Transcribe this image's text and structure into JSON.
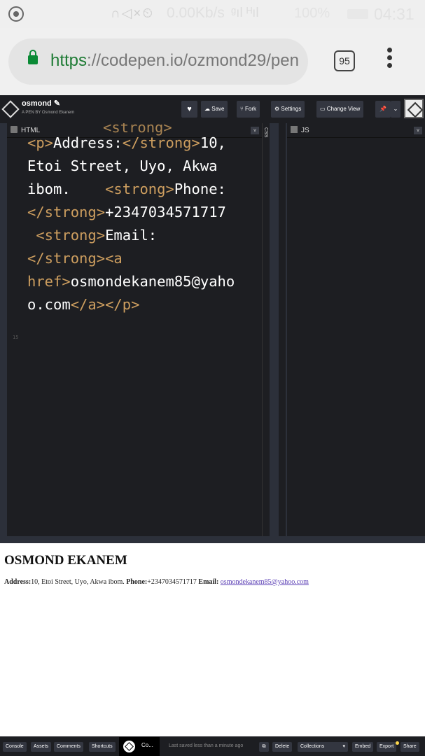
{
  "status_bar": {
    "net_speed": "0.00Kb/s",
    "battery": "100%",
    "time": "04:31"
  },
  "browser": {
    "url_protocol": "https",
    "url_rest": "://codepen.io/ozmond29/pen",
    "tab_count": "95"
  },
  "pen": {
    "title": "osmond",
    "byline": "A PEN BY Osmond Ekanem",
    "buttons": {
      "save": "Save",
      "fork": "Fork",
      "settings": "Settings",
      "change_view": "Change View"
    }
  },
  "editor": {
    "html_label": "HTML",
    "css_label": "CSS",
    "js_label": "JS",
    "code": {
      "partial_top": "<strong>",
      "line1_tag_open": "<p>",
      "line1_text": "Address:",
      "line1_tag_close": "</strong>",
      "line1_value": "10,",
      "line2": "Etoi Street, Uyo, Akwa",
      "line3_text": "ibom.    ",
      "line3_tag": "<strong>",
      "line3_value": "Phone:",
      "line4_tag": "</strong>",
      "line4_value": "+2347034571717",
      "line5_tag": " <strong>",
      "line5_value": "Email:",
      "line6_tag": "</strong><a",
      "line7_tag": "href>",
      "line7_value": "osmondekanem85@yaho",
      "line8_value": "o.com",
      "line8_tag": "</a></p>",
      "gutter_marker": "15"
    }
  },
  "preview": {
    "heading": "OSMOND EKANEM",
    "address_label": "Address:",
    "address_value": "10, Etoi Street, Uyo, Akwa ibom.",
    "phone_label": "Phone:",
    "phone_value": "+2347034571717",
    "email_label": "Email:",
    "email_value": "osmondekanem85@yahoo.com"
  },
  "bottom_bar": {
    "console": "Console",
    "assets": "Assets",
    "comments": "Comments",
    "shortcuts": "Shortcuts",
    "logo_text": "Co...",
    "status": "Last saved less than a minute ago",
    "delete": "Delete",
    "collections": "Collections",
    "embed": "Embed",
    "export": "Export",
    "share": "Share"
  }
}
